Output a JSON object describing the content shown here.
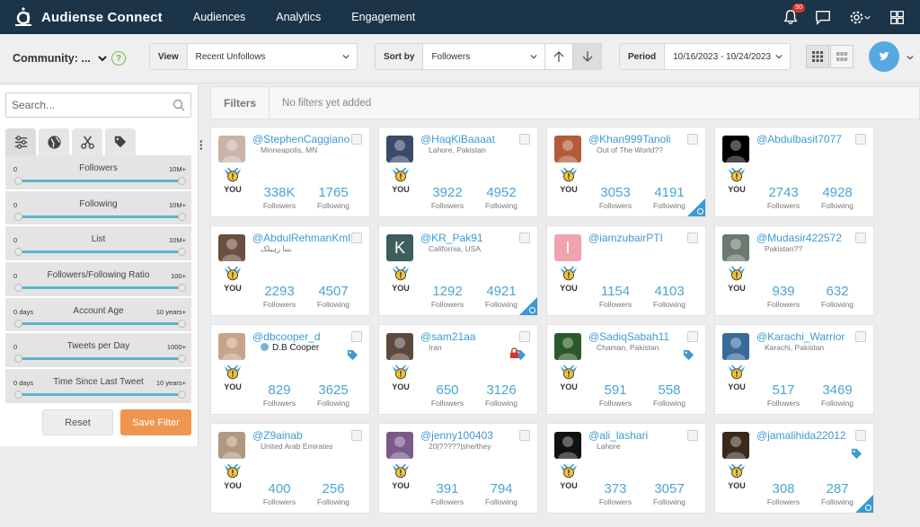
{
  "app": {
    "title": "Audiense Connect"
  },
  "nav": {
    "links": [
      "Audiences",
      "Analytics",
      "Engagement"
    ],
    "notifications": "50"
  },
  "toolbar": {
    "community_label": "Community: ...",
    "help": "?",
    "view_label": "View",
    "view_value": "Recent Unfollows",
    "sort_label": "Sort by",
    "sort_value": "Followers",
    "period_label": "Period",
    "period_value": "10/16/2023 - 10/24/2023"
  },
  "sidebar": {
    "search_placeholder": "Search...",
    "filters": [
      {
        "name": "Followers",
        "min": "0",
        "max": "10M+"
      },
      {
        "name": "Following",
        "min": "0",
        "max": "10M+"
      },
      {
        "name": "List",
        "min": "0",
        "max": "10M+"
      },
      {
        "name": "Followers/Following Ratio",
        "min": "0",
        "max": "100+"
      },
      {
        "name": "Account Age",
        "min": "0 days",
        "max": "10 years+"
      },
      {
        "name": "Tweets per Day",
        "min": "0",
        "max": "1000+"
      },
      {
        "name": "Time Since Last Tweet",
        "min": "0 days",
        "max": "10 years+"
      }
    ],
    "reset_label": "Reset",
    "save_label": "Save Filter"
  },
  "filterbar": {
    "label": "Filters",
    "empty": "No filters yet added"
  },
  "labels": {
    "you": "YOU",
    "followers": "Followers",
    "following": "Following"
  },
  "cards": [
    {
      "handle": "@StephenCaggiano",
      "location": "Minneapolis, MN",
      "followers": "338K",
      "following": "1765",
      "avatar_color": "#c9b4a8"
    },
    {
      "handle": "@HaqKiBaaaat",
      "location": "Lahore, Pakistan",
      "followers": "3922",
      "following": "4952",
      "avatar_color": "#3a4a6a"
    },
    {
      "handle": "@Khan999Tanoli",
      "location": "Out of The World??",
      "followers": "3053",
      "following": "4191",
      "avatar_color": "#b45a3a"
    },
    {
      "handle": "@Abdulbasit7077",
      "location": "",
      "followers": "2743",
      "following": "4928",
      "avatar_color": "#000000"
    },
    {
      "handle": "@AbdulRehmanKml",
      "location": "بتنا رہیلک",
      "followers": "2293",
      "following": "4507",
      "avatar_color": "#6a5040"
    },
    {
      "handle": "@KR_Pak91",
      "location": "California, USA",
      "followers": "1292",
      "following": "4921",
      "avatar_color": "#3d5e5c",
      "avatar_letter": "K"
    },
    {
      "handle": "@iamzubairPTI",
      "location": "",
      "followers": "1154",
      "following": "4103",
      "avatar_color": "#f0a2ae",
      "avatar_letter": "I"
    },
    {
      "handle": "@Mudasir422572",
      "location": "Pakistan??",
      "followers": "939",
      "following": "632",
      "avatar_color": "#6a7a70"
    },
    {
      "handle": "@dbcooper_d",
      "location": "D.B Cooper",
      "followers": "829",
      "following": "3625",
      "avatar_color": "#c9a48a"
    },
    {
      "handle": "@sam21aa",
      "location": "Iran",
      "followers": "650",
      "following": "3126",
      "avatar_color": "#5a4a40"
    },
    {
      "handle": "@SadiqSabah11",
      "location": "Chaman, Pakistan",
      "followers": "591",
      "following": "558",
      "avatar_color": "#2a5a2a"
    },
    {
      "handle": "@Karachi_Warrior",
      "location": "Karachi, Pakistan",
      "followers": "517",
      "following": "3469",
      "avatar_color": "#3a6a9a"
    },
    {
      "handle": "@Z9ainab",
      "location": "United Arab Emirates",
      "followers": "400",
      "following": "256",
      "avatar_color": "#b09880"
    },
    {
      "handle": "@jenny100403",
      "location": "20|?????|she/they",
      "followers": "391",
      "following": "794",
      "avatar_color": "#7a5a8a"
    },
    {
      "handle": "@ali_lashari",
      "location": "Lahore",
      "followers": "373",
      "following": "3057",
      "avatar_color": "#111111"
    },
    {
      "handle": "@jamalihida22012",
      "location": "",
      "followers": "308",
      "following": "287",
      "avatar_color": "#3a2a1a"
    }
  ]
}
